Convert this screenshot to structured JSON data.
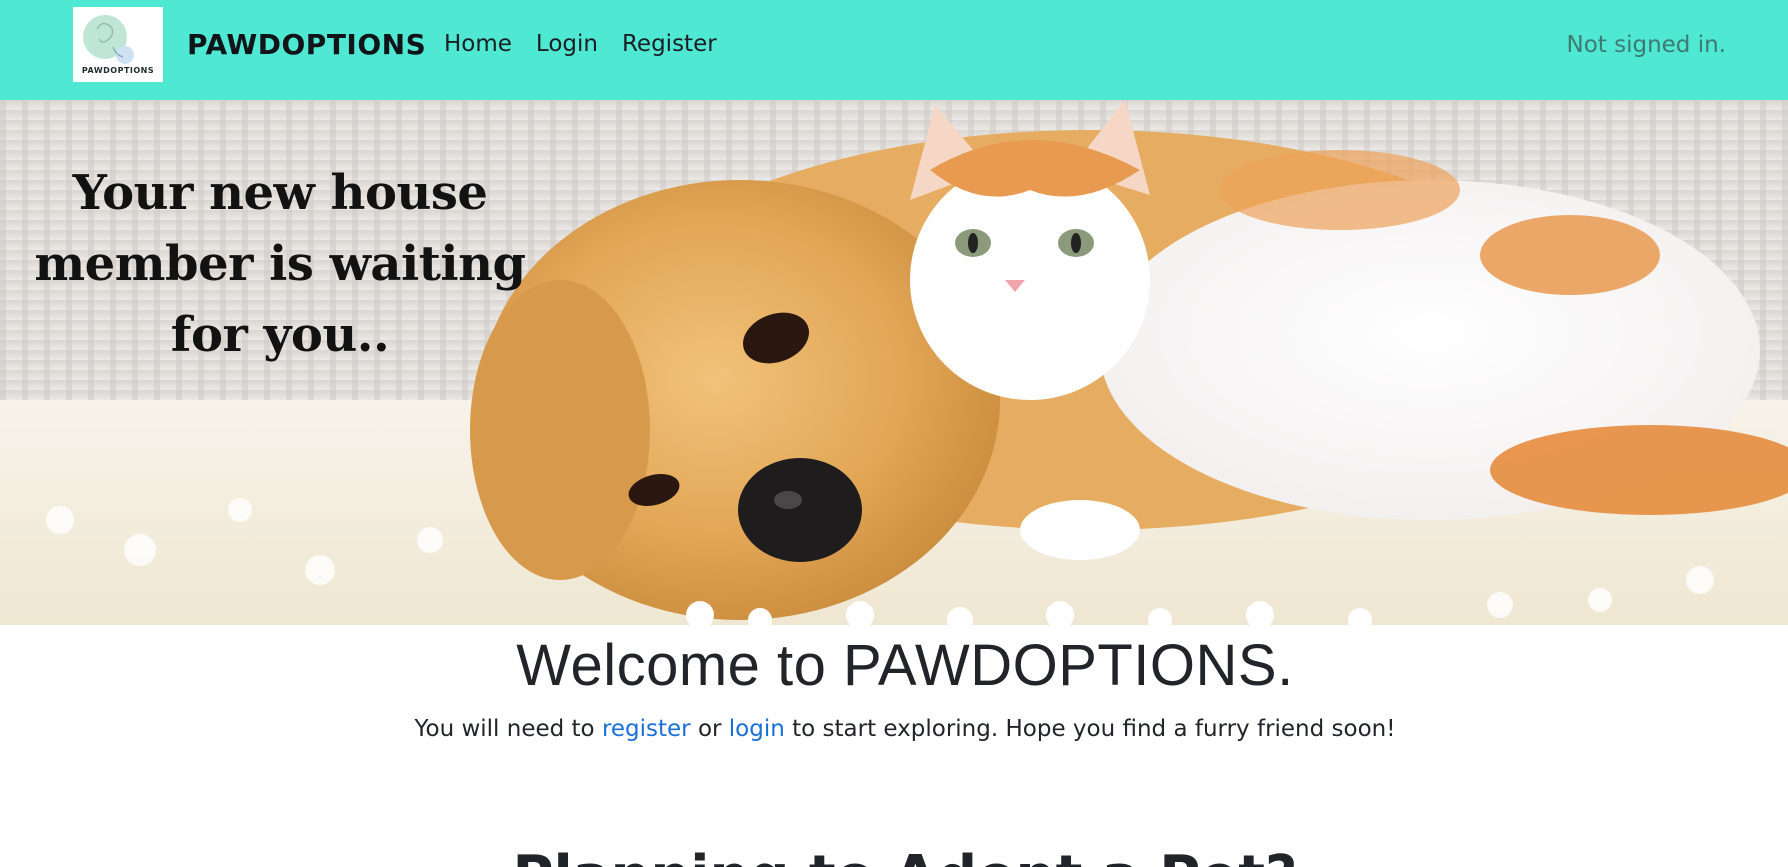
{
  "navbar": {
    "brand": "PAWDOPTIONS",
    "logo_text": "PAWDOPTIONS",
    "links": [
      {
        "label": "Home"
      },
      {
        "label": "Login"
      },
      {
        "label": "Register"
      }
    ],
    "status": "Not signed in.",
    "background_color": "#4fe8d3"
  },
  "hero": {
    "caption_lines": [
      "Your new house",
      "member is waiting",
      "for you.."
    ],
    "image_alt": "golden retriever and orange-white cat lying together on a white rug"
  },
  "main": {
    "welcome_title": "Welcome to PAWDOPTIONS.",
    "intro": {
      "before": "You will need to ",
      "register_link": "register",
      "middle": " or ",
      "login_link": "login",
      "after": " to start exploring. Hope you find a furry friend soon!"
    },
    "next_heading": "Planning to Adopt a Pet?",
    "link_color": "#1a6fd8"
  }
}
